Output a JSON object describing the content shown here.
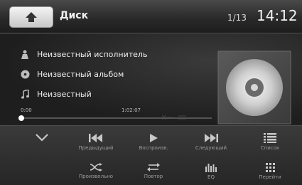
{
  "header": {
    "home_icon": "home-icon",
    "title": "Диск",
    "track_count": "1/13",
    "clock": "14:12"
  },
  "track": {
    "artist": "Неизвестный исполнитель",
    "album": "Неизвестный альбом",
    "song": "Неизвестный",
    "time_elapsed": "0:00",
    "time_total": "1:02:07",
    "progress": 0.0
  },
  "controls": {
    "collapse_icon": "chevron-down-icon",
    "prev_label": "Предыдущий",
    "play_label": "Воспроизв.",
    "next_label": "Следующий",
    "list_label": "Список",
    "shuffle_label": "Произвольно",
    "repeat_label": "Повтор",
    "eq_label": "EQ",
    "goto_label": "Перейти"
  },
  "colors": {
    "header_bg": "#2a2a2a",
    "panel_bg": "#2e2e2e",
    "label_gray": "#9c9c9c",
    "icon_gray": "#b0b0b0"
  }
}
